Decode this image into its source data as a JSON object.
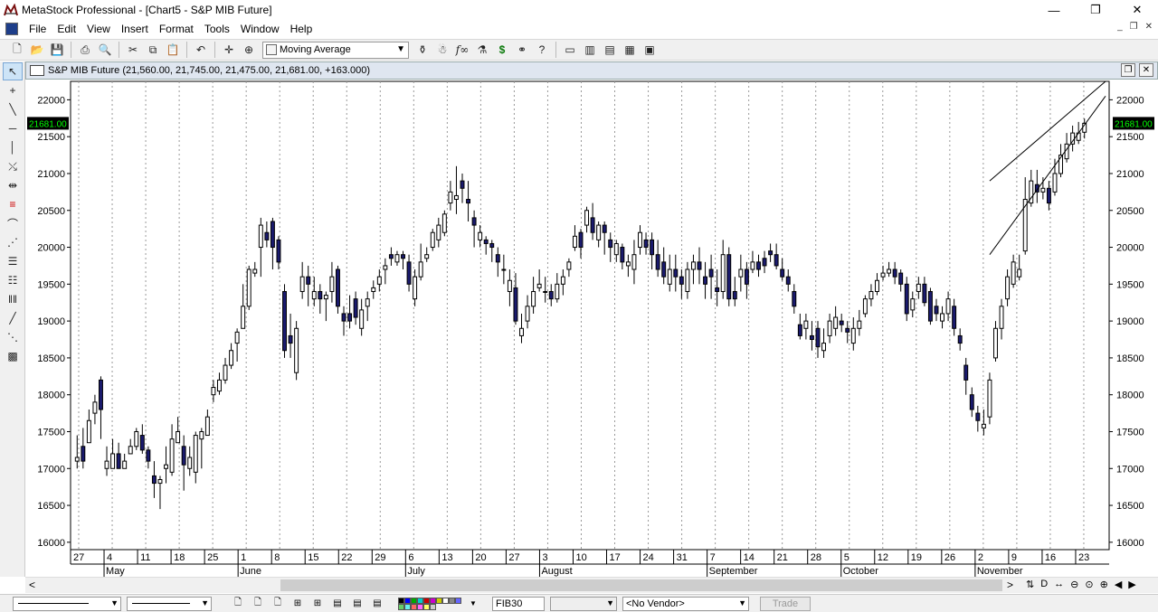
{
  "window": {
    "title": "MetaStock Professional - [Chart5 - S&P MIB Future]",
    "buttons": [
      "—",
      "❐",
      "✕"
    ]
  },
  "menu": {
    "items": [
      "File",
      "Edit",
      "View",
      "Insert",
      "Format",
      "Tools",
      "Window",
      "Help"
    ]
  },
  "toolbar": {
    "indicator_value": "Moving Average",
    "icons": [
      "new-icon",
      "open-icon",
      "save-icon",
      "print-icon",
      "print-preview-icon",
      "cut-icon",
      "copy-icon",
      "paste-icon",
      "undo-icon",
      "crosshair-icon",
      "zoom-icon",
      "indicator-icon",
      "expert-icon",
      "function-icon",
      "system-tester-icon",
      "dollar-icon",
      "explorer-icon",
      "help-pointer-icon",
      "layout-icon",
      "tile-icon",
      "horizontal-icon",
      "grid-icon",
      "template-icon"
    ]
  },
  "chart": {
    "caption": "S&P MIB Future (21,560.00, 21,745.00, 21,475.00, 21,681.00, +163.000)",
    "last_price": "21681.00",
    "y_ticks": [
      "22000",
      "21500",
      "21000",
      "20500",
      "20000",
      "19500",
      "19000",
      "18500",
      "18000",
      "17500",
      "17000",
      "16500",
      "16000"
    ],
    "x_days": [
      "27",
      "4",
      "11",
      "18",
      "25",
      "1",
      "8",
      "15",
      "22",
      "29",
      "6",
      "13",
      "20",
      "27",
      "3",
      "10",
      "17",
      "24",
      "31",
      "7",
      "14",
      "21",
      "28",
      "5",
      "12",
      "19",
      "26",
      "2",
      "9",
      "16",
      "23"
    ],
    "x_months": [
      "May",
      "June",
      "July",
      "August",
      "September",
      "October",
      "November"
    ]
  },
  "chart_data": {
    "type": "candlestick",
    "title": "S&P MIB Future",
    "ylim": [
      15900,
      22250
    ],
    "grid": "vertical-dotted",
    "up_color": "#ffffff",
    "down_color": "#1a1a6e",
    "candles": [
      [
        17100,
        17150,
        17450,
        17000
      ],
      [
        17300,
        17100,
        17550,
        17000
      ],
      [
        17350,
        17650,
        17800,
        17350
      ],
      [
        17750,
        17900,
        18000,
        17600
      ],
      [
        18200,
        17800,
        18250,
        17400
      ],
      [
        17000,
        17100,
        17300,
        16900
      ],
      [
        17000,
        17200,
        17400,
        17000
      ],
      [
        17200,
        17000,
        17350,
        17000
      ],
      [
        17000,
        17100,
        17200,
        17000
      ],
      [
        17200,
        17300,
        17400,
        17200
      ],
      [
        17300,
        17500,
        17550,
        17250
      ],
      [
        17450,
        17250,
        17600,
        17200
      ],
      [
        17250,
        17100,
        17300,
        17000
      ],
      [
        16900,
        16800,
        17100,
        16600
      ],
      [
        16800,
        16850,
        16900,
        16450
      ],
      [
        17000,
        17050,
        17300,
        16800
      ],
      [
        16950,
        17400,
        17600,
        16900
      ],
      [
        17350,
        17500,
        17700,
        17350
      ],
      [
        17300,
        17050,
        17450,
        16700
      ],
      [
        17000,
        17150,
        17300,
        16900
      ],
      [
        16950,
        17450,
        17500,
        16800
      ],
      [
        17400,
        17500,
        17550,
        17000
      ],
      [
        17450,
        17700,
        17800,
        17450
      ],
      [
        18000,
        18100,
        18200,
        17900
      ],
      [
        18050,
        18200,
        18300,
        18000
      ],
      [
        18200,
        18400,
        18500,
        18150
      ],
      [
        18400,
        18600,
        18700,
        18350
      ],
      [
        18700,
        18850,
        18900,
        18450
      ],
      [
        18900,
        19200,
        19500,
        18900
      ],
      [
        19200,
        19700,
        19750,
        19150
      ],
      [
        19650,
        19700,
        19800,
        19600
      ],
      [
        20000,
        20300,
        20400,
        19600
      ],
      [
        20200,
        20100,
        20350,
        20000
      ],
      [
        20350,
        20000,
        20400,
        19700
      ],
      [
        20100,
        19800,
        20150,
        19700
      ],
      [
        19400,
        18600,
        19500,
        18500
      ],
      [
        18800,
        18700,
        19100,
        18500
      ],
      [
        18300,
        18900,
        19000,
        18200
      ],
      [
        19400,
        19600,
        19800,
        19300
      ],
      [
        19600,
        19500,
        19750,
        19200
      ],
      [
        19300,
        19400,
        19600,
        19200
      ],
      [
        19400,
        19300,
        19500,
        19100
      ],
      [
        19300,
        19350,
        19400,
        19000
      ],
      [
        19400,
        19600,
        19800,
        19250
      ],
      [
        19700,
        19200,
        19750,
        19100
      ],
      [
        19100,
        19000,
        19200,
        18800
      ],
      [
        19100,
        19000,
        19350,
        18900
      ],
      [
        19300,
        19050,
        19400,
        18950
      ],
      [
        18900,
        19150,
        19300,
        18800
      ],
      [
        19200,
        19300,
        19400,
        19000
      ],
      [
        19400,
        19450,
        19550,
        19300
      ],
      [
        19500,
        19600,
        19700,
        19400
      ],
      [
        19700,
        19750,
        19850,
        19500
      ],
      [
        19900,
        19850,
        20000,
        19750
      ],
      [
        19800,
        19900,
        19950,
        19750
      ],
      [
        19900,
        19850,
        19950,
        19700
      ],
      [
        19800,
        19500,
        19900,
        19400
      ],
      [
        19300,
        19600,
        19700,
        19200
      ],
      [
        19600,
        19800,
        20050,
        19550
      ],
      [
        19850,
        19900,
        20000,
        19800
      ],
      [
        20000,
        20200,
        20250,
        19950
      ],
      [
        20100,
        20300,
        20400,
        20000
      ],
      [
        20200,
        20450,
        20500,
        20150
      ],
      [
        20600,
        20750,
        20900,
        20500
      ],
      [
        20650,
        20700,
        21100,
        20450
      ],
      [
        20900,
        20800,
        21000,
        20600
      ],
      [
        20650,
        20600,
        20900,
        20350
      ],
      [
        20400,
        20300,
        20500,
        20000
      ],
      [
        20100,
        20200,
        20300,
        20000
      ],
      [
        20100,
        20050,
        20150,
        19900
      ],
      [
        20050,
        20000,
        20100,
        19800
      ],
      [
        19900,
        19800,
        20000,
        19600
      ],
      [
        19700,
        19700,
        19900,
        19500
      ],
      [
        19400,
        19550,
        19700,
        19200
      ],
      [
        19450,
        19000,
        19650,
        18950
      ],
      [
        18800,
        18900,
        19100,
        18700
      ],
      [
        19000,
        19200,
        19350,
        18900
      ],
      [
        19200,
        19400,
        19600,
        19100
      ],
      [
        19450,
        19500,
        19700,
        19400
      ],
      [
        19400,
        19400,
        19600,
        19250
      ],
      [
        19400,
        19300,
        19500,
        19200
      ],
      [
        19300,
        19500,
        19650,
        19250
      ],
      [
        19500,
        19600,
        19700,
        19350
      ],
      [
        19700,
        19800,
        19850,
        19600
      ],
      [
        20000,
        20150,
        20300,
        19950
      ],
      [
        20200,
        20000,
        20250,
        19850
      ],
      [
        20300,
        20500,
        20550,
        20200
      ],
      [
        20400,
        20200,
        20600,
        20100
      ],
      [
        20100,
        20300,
        20350,
        20000
      ],
      [
        20300,
        20200,
        20350,
        19900
      ],
      [
        20100,
        20000,
        20200,
        19800
      ],
      [
        19900,
        20050,
        20100,
        19800
      ],
      [
        20000,
        19800,
        20050,
        19700
      ],
      [
        19750,
        19800,
        19900,
        19600
      ],
      [
        19700,
        19900,
        20100,
        19500
      ],
      [
        20000,
        20200,
        20300,
        19900
      ],
      [
        20100,
        20000,
        20200,
        19900
      ],
      [
        20100,
        19900,
        20200,
        19700
      ],
      [
        19900,
        19700,
        20100,
        19600
      ],
      [
        19800,
        19600,
        20000,
        19500
      ],
      [
        19500,
        19700,
        19900,
        19400
      ],
      [
        19700,
        19600,
        19900,
        19400
      ],
      [
        19600,
        19500,
        19700,
        19300
      ],
      [
        19400,
        19700,
        19800,
        19300
      ],
      [
        19700,
        19800,
        19900,
        19500
      ],
      [
        19800,
        19700,
        20000,
        19500
      ],
      [
        19600,
        19500,
        19800,
        19300
      ],
      [
        19700,
        19600,
        19900,
        19300
      ],
      [
        19450,
        19400,
        19700,
        19200
      ],
      [
        19400,
        19900,
        20100,
        19300
      ],
      [
        19900,
        19300,
        20000,
        19200
      ],
      [
        19400,
        19300,
        19600,
        19200
      ],
      [
        19600,
        19700,
        19900,
        19400
      ],
      [
        19700,
        19500,
        19800,
        19300
      ],
      [
        19700,
        19800,
        19950,
        19650
      ],
      [
        19800,
        19700,
        19900,
        19600
      ],
      [
        19850,
        19750,
        19950,
        19650
      ],
      [
        19950,
        19900,
        20050,
        19800
      ],
      [
        19900,
        19750,
        20050,
        19700
      ],
      [
        19700,
        19600,
        19850,
        19550
      ],
      [
        19600,
        19500,
        19700,
        19400
      ],
      [
        19400,
        19200,
        19500,
        19100
      ],
      [
        18950,
        18800,
        19100,
        18750
      ],
      [
        18900,
        19000,
        19100,
        18750
      ],
      [
        18800,
        18750,
        19000,
        18600
      ],
      [
        18900,
        18650,
        19000,
        18500
      ],
      [
        18600,
        18700,
        18900,
        18500
      ],
      [
        18800,
        19000,
        19100,
        18700
      ],
      [
        18900,
        19050,
        19200,
        18800
      ],
      [
        19000,
        18950,
        19100,
        18850
      ],
      [
        18900,
        18850,
        19000,
        18700
      ],
      [
        18700,
        18900,
        19050,
        18600
      ],
      [
        18900,
        19000,
        19150,
        18800
      ],
      [
        19100,
        19300,
        19350,
        19050
      ],
      [
        19300,
        19400,
        19500,
        19200
      ],
      [
        19400,
        19550,
        19650,
        19350
      ],
      [
        19600,
        19650,
        19750,
        19550
      ],
      [
        19650,
        19700,
        19800,
        19600
      ],
      [
        19700,
        19600,
        19800,
        19500
      ],
      [
        19650,
        19500,
        19700,
        19400
      ],
      [
        19500,
        19100,
        19600,
        19000
      ],
      [
        19150,
        19300,
        19400,
        19050
      ],
      [
        19400,
        19500,
        19600,
        19300
      ],
      [
        19500,
        19250,
        19600,
        19200
      ],
      [
        19400,
        19000,
        19450,
        18950
      ],
      [
        19200,
        19100,
        19300,
        19000
      ],
      [
        19000,
        19100,
        19200,
        18900
      ],
      [
        19100,
        19300,
        19400,
        19000
      ],
      [
        19200,
        18900,
        19300,
        18800
      ],
      [
        18800,
        18700,
        18900,
        18600
      ],
      [
        18400,
        18200,
        18500,
        18000
      ],
      [
        18000,
        17800,
        18100,
        17700
      ],
      [
        17750,
        17650,
        17850,
        17500
      ],
      [
        17550,
        17600,
        17800,
        17450
      ],
      [
        17700,
        18200,
        18300,
        17600
      ],
      [
        18500,
        18900,
        19000,
        18450
      ],
      [
        18900,
        19200,
        19300,
        18750
      ],
      [
        19300,
        19600,
        19700,
        19200
      ],
      [
        19500,
        19800,
        19900,
        19450
      ],
      [
        19600,
        19700,
        19900,
        19550
      ],
      [
        19950,
        20650,
        20950,
        19900
      ],
      [
        20600,
        20900,
        21050,
        20550
      ],
      [
        20850,
        20750,
        21050,
        20600
      ],
      [
        20750,
        20800,
        20950,
        20650
      ],
      [
        20800,
        20600,
        20900,
        20500
      ],
      [
        20750,
        21000,
        21200,
        20700
      ],
      [
        21000,
        21250,
        21400,
        20950
      ],
      [
        21200,
        21400,
        21550,
        21150
      ],
      [
        21400,
        21550,
        21650,
        21300
      ],
      [
        21450,
        21550,
        21700,
        21400
      ],
      [
        21560,
        21681,
        21745,
        21475
      ]
    ]
  }
}
